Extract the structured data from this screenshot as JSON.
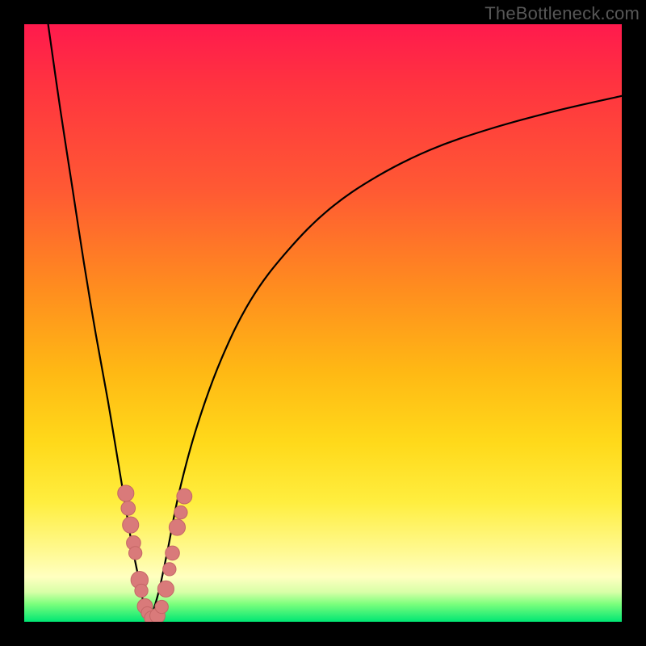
{
  "watermark": "TheBottleneck.com",
  "colors": {
    "background_frame": "#000000",
    "gradient_top": "#ff1a4d",
    "gradient_mid": "#ffd91a",
    "gradient_bottom": "#00e673",
    "curve": "#000000",
    "marker_fill": "#d97a7a",
    "marker_stroke": "#c46666"
  },
  "chart_data": {
    "type": "line",
    "title": "",
    "xlabel": "",
    "ylabel": "",
    "xlim": [
      0,
      100
    ],
    "ylim": [
      0,
      100
    ],
    "notch_x": 21,
    "series": [
      {
        "name": "left-branch",
        "x": [
          4,
          6,
          8,
          10,
          12,
          14,
          16,
          17,
          18,
          19,
          20,
          21
        ],
        "y": [
          100,
          86,
          73,
          60,
          48,
          37,
          25,
          19,
          13,
          8,
          3,
          0
        ]
      },
      {
        "name": "right-branch",
        "x": [
          21,
          22.5,
          24,
          26,
          29,
          33,
          38,
          44,
          51,
          59,
          68,
          78,
          89,
          100
        ],
        "y": [
          0,
          5,
          12,
          22,
          33,
          44,
          54,
          62,
          69,
          74.5,
          79,
          82.5,
          85.5,
          88
        ]
      }
    ],
    "markers": [
      {
        "x": 17.0,
        "y": 21.5,
        "r": 1.6
      },
      {
        "x": 17.4,
        "y": 19.0,
        "r": 1.4
      },
      {
        "x": 17.8,
        "y": 16.2,
        "r": 1.6
      },
      {
        "x": 18.3,
        "y": 13.2,
        "r": 1.4
      },
      {
        "x": 18.6,
        "y": 11.5,
        "r": 1.3
      },
      {
        "x": 19.3,
        "y": 7.0,
        "r": 1.7
      },
      {
        "x": 19.6,
        "y": 5.2,
        "r": 1.3
      },
      {
        "x": 20.2,
        "y": 2.6,
        "r": 1.5
      },
      {
        "x": 20.6,
        "y": 1.5,
        "r": 1.2
      },
      {
        "x": 21.3,
        "y": 0.6,
        "r": 1.4
      },
      {
        "x": 22.3,
        "y": 1.0,
        "r": 1.5
      },
      {
        "x": 23.0,
        "y": 2.5,
        "r": 1.3
      },
      {
        "x": 23.7,
        "y": 5.5,
        "r": 1.6
      },
      {
        "x": 24.3,
        "y": 8.8,
        "r": 1.3
      },
      {
        "x": 24.8,
        "y": 11.5,
        "r": 1.4
      },
      {
        "x": 25.6,
        "y": 15.8,
        "r": 1.6
      },
      {
        "x": 26.2,
        "y": 18.3,
        "r": 1.3
      },
      {
        "x": 26.8,
        "y": 21.0,
        "r": 1.5
      }
    ]
  }
}
